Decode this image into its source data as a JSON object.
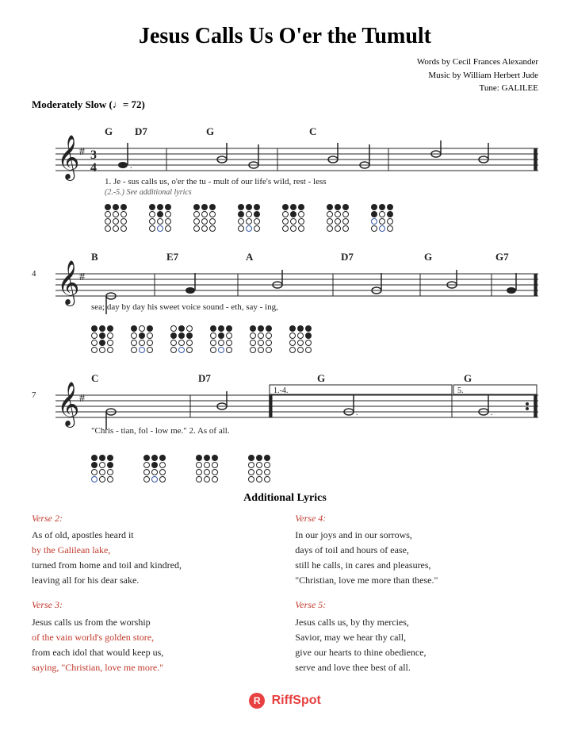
{
  "title": "Jesus Calls Us O'er the Tumult",
  "attribution": {
    "words": "Words by Cecil Frances Alexander",
    "music": "Music by William Herbert Jude",
    "tune": "Tune: GALILEE"
  },
  "tempo": {
    "marking": "Moderately Slow",
    "bpm_symbol": "♩= 72"
  },
  "sections": {
    "section1": {
      "bar_number": "",
      "chords": [
        "G",
        "D7",
        "G",
        "C"
      ],
      "lyrics_line1": "1. Je - sus  calls  us,   o'er  the  tu - mult  of  our  life's  wild,  rest - less",
      "lyrics_line2": "(2.-5.)  See additional lyrics"
    },
    "section2": {
      "bar_number": "4",
      "chords": [
        "B",
        "E7",
        "A",
        "D7",
        "G",
        "G7"
      ],
      "lyrics": "sea;       day  by  day    his  sweet  voice  sound - eth,   say - ing,"
    },
    "section3": {
      "bar_number": "7",
      "chords_left": [
        "C",
        "D7"
      ],
      "chords_right": [
        "G",
        "G"
      ],
      "repeat_bracket_left": "1.-4.",
      "repeat_bracket_right": "5.",
      "lyrics": "\"Chris -  tian,    fol - low   me.\"       2. As    of         all."
    }
  },
  "additional_lyrics": {
    "title": "Additional Lyrics",
    "verses": [
      {
        "id": "verse2",
        "title": "Verse 2:",
        "lines": [
          "As of old, apostles heard it",
          "by the Galilean lake,",
          "turned from home and toil and kindred,",
          "leaving all for his dear sake."
        ],
        "red_lines": [
          1,
          2
        ]
      },
      {
        "id": "verse3",
        "title": "Verse 3:",
        "lines": [
          "Jesus calls us from the worship",
          "of the vain world's golden store,",
          "from each idol that would keep us,",
          "saying, \"Christian, love me more.\""
        ],
        "red_lines": [
          1,
          3
        ]
      },
      {
        "id": "verse4",
        "title": "Verse 4:",
        "lines": [
          "In our joys and in our sorrows,",
          "days of toil and hours of ease,",
          "still he calls, in cares and pleasures,",
          "\"Christian, love me more than these.\""
        ],
        "red_lines": []
      },
      {
        "id": "verse5",
        "title": "Verse 5:",
        "lines": [
          "Jesus calls us, by thy mercies,",
          "Savior, may we hear thy call,",
          "give our hearts to thine obedience,",
          "serve and love thee best of all."
        ],
        "red_lines": []
      }
    ]
  },
  "logo": {
    "icon": "R",
    "name": "RiffSpot"
  }
}
